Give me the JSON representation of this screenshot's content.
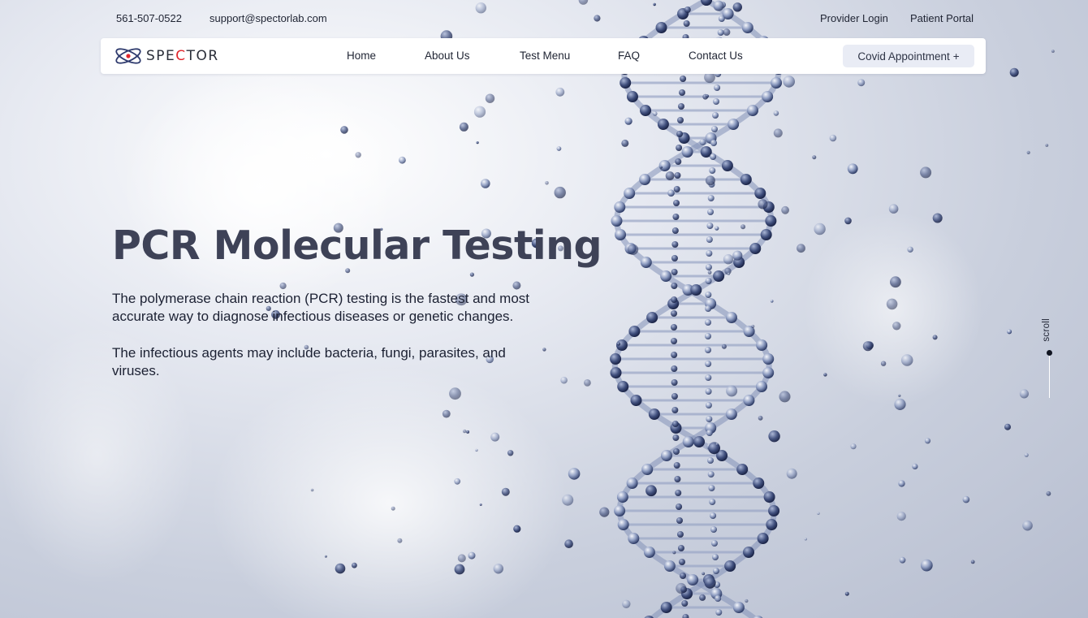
{
  "topbar": {
    "phone": "561-507-0522",
    "email": "support@spectorlab.com",
    "provider_login": "Provider Login",
    "patient_portal": "Patient Portal"
  },
  "logo": {
    "text_a": "SPE",
    "text_b": "C",
    "text_c": "TOR"
  },
  "nav": {
    "items": [
      {
        "label": "Home"
      },
      {
        "label": "About Us"
      },
      {
        "label": "Test Menu"
      },
      {
        "label": "FAQ"
      },
      {
        "label": "Contact Us"
      }
    ],
    "cta_label": "Covid Appointment",
    "cta_icon": "+"
  },
  "hero": {
    "title": "PCR Molecular Testing",
    "paragraph1": "The polymerase chain reaction (PCR) testing is the fastest and most accurate way to diagnose infectious diseases or genetic changes.",
    "paragraph2": "The infectious agents may include bacteria, fungi, parasites, and viruses."
  },
  "scroll_indicator": {
    "label": "scroll"
  },
  "colors": {
    "accent_red": "#e0262c",
    "title": "#3e4257",
    "button_bg": "#e9ecf5",
    "helix": "#6d7ea6"
  }
}
